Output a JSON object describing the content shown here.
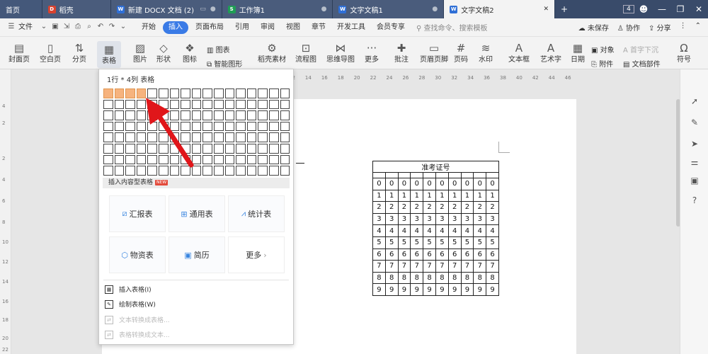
{
  "tabs": {
    "home": "首页",
    "daoke": "稻壳",
    "docx": "新建 DOCX 文档 (2)",
    "sheet": "工作簿1",
    "doc1": "文字文稿1",
    "doc2": "文字文稿2",
    "new_tab": "+",
    "window_count": "4"
  },
  "menu": {
    "file": "文件",
    "items": [
      "开始",
      "插入",
      "页面布局",
      "引用",
      "审阅",
      "视图",
      "章节",
      "开发工具",
      "会员专享"
    ],
    "search_placeholder": "查找命令、搜索模板",
    "unsaved": "未保存",
    "collab": "协作",
    "share": "分享"
  },
  "ribbon": {
    "cover": "封面页",
    "blank": "空白页",
    "pagebreak": "分页",
    "table": "表格",
    "picture": "图片",
    "shape": "形状",
    "icon": "图标",
    "chart": "图表",
    "smart": "智能图形",
    "material": "稻壳素材",
    "flowchart": "流程图",
    "mindmap": "思维导图",
    "more": "更多",
    "comment": "批注",
    "header": "页眉页脚",
    "pagenum": "页码",
    "watermark": "水印",
    "textbox": "文本框",
    "wordart": "艺术字",
    "date": "日期",
    "object": "对象",
    "dropcap": "首字下沉",
    "attach": "附件",
    "docpart": "文档部件",
    "symbol": "符号"
  },
  "ruler": {
    "top": [
      "12",
      "14",
      "16",
      "18",
      "20",
      "22",
      "24",
      "26",
      "28",
      "30",
      "32",
      "34",
      "36",
      "38",
      "40",
      "42",
      "44",
      "46"
    ],
    "left": [
      "4",
      "2",
      "2",
      "4",
      "6",
      "8",
      "10",
      "12",
      "14",
      "16",
      "18",
      "20",
      "22"
    ]
  },
  "dropdown": {
    "grid_label": "1行 * 4列 表格",
    "grid_rows": 8,
    "grid_cols": 17,
    "selected_rows": 1,
    "selected_cols": 4,
    "section_title": "插入内容型表格",
    "new_badge": "NEW",
    "cards": [
      "汇报表",
      "通用表",
      "统计表",
      "物资表",
      "简历",
      "更多"
    ],
    "menu_items": [
      {
        "label": "插入表格(I)",
        "enabled": true
      },
      {
        "label": "绘制表格(W)",
        "enabled": true
      },
      {
        "label": "文本转换成表格...",
        "enabled": false
      },
      {
        "label": "表格转换成文本...",
        "enabled": false
      }
    ]
  },
  "exam_table": {
    "title": "准考证号",
    "digits": [
      "0",
      "1",
      "2",
      "3",
      "4",
      "5",
      "6",
      "7",
      "8",
      "9"
    ],
    "columns": 10
  },
  "colors": {
    "tabbar": "#394b6a",
    "accent": "#3a7be6",
    "cell_highlight": "#f6b37e",
    "arrow": "#e0161a"
  }
}
